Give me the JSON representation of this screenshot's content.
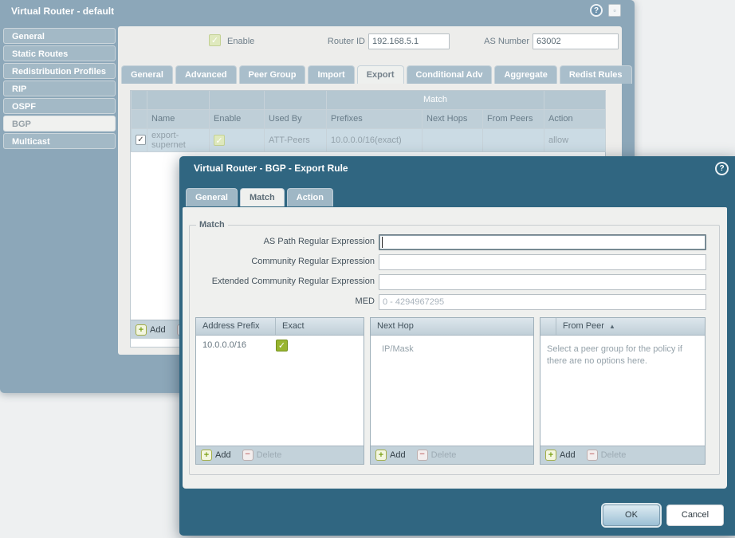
{
  "icons": {
    "check": "✓",
    "plus": "+",
    "minus": "−",
    "help": "?",
    "window": "▫",
    "sort_asc": "▲"
  },
  "router_dialog": {
    "title": "Virtual Router - default",
    "sidebar": [
      "General",
      "Static Routes",
      "Redistribution Profiles",
      "RIP",
      "OSPF",
      "BGP",
      "Multicast"
    ],
    "selected_sidebar": "BGP",
    "enable_label": "Enable",
    "router_id_label": "Router ID",
    "router_id_value": "192.168.5.1",
    "as_number_label": "AS Number",
    "as_number_value": "63002",
    "tabs": [
      "General",
      "Advanced",
      "Peer Group",
      "Import",
      "Export",
      "Conditional Adv",
      "Aggregate",
      "Redist Rules"
    ],
    "active_tab": "Export",
    "table": {
      "group_header": "Match",
      "columns": [
        "Name",
        "Enable",
        "Used By",
        "Prefixes",
        "Next Hops",
        "From Peers",
        "Action"
      ],
      "row": {
        "name_line1": "export-",
        "name_line2": "supernet",
        "used_by": "ATT-Peers",
        "prefixes": "10.0.0.0/16(exact)",
        "next_hops": "",
        "from_peers": "",
        "action": "allow"
      }
    }
  },
  "export_rule_dialog": {
    "title": "Virtual Router - BGP - Export Rule",
    "tabs": [
      "General",
      "Match",
      "Action"
    ],
    "active_tab": "Match",
    "fieldset_legend": "Match",
    "fields": {
      "as_path_label": "AS Path Regular Expression",
      "as_path_value": "",
      "community_label": "Community Regular Expression",
      "community_value": "",
      "ext_community_label": "Extended Community Regular Expression",
      "ext_community_value": "",
      "med_label": "MED",
      "med_placeholder": "0 - 4294967295"
    },
    "address_panel": {
      "col1": "Address Prefix",
      "col2": "Exact",
      "row_prefix": "10.0.0.0/16",
      "row_exact_checked": true
    },
    "next_hop_panel": {
      "col1": "Next Hop",
      "placeholder": "IP/Mask"
    },
    "from_peer_panel": {
      "col1": "From Peer",
      "empty_text": "Select a peer group for the policy if there are no options here."
    },
    "ok_label": "OK",
    "cancel_label": "Cancel"
  },
  "actions": {
    "add": "Add",
    "delete": "Delete"
  }
}
